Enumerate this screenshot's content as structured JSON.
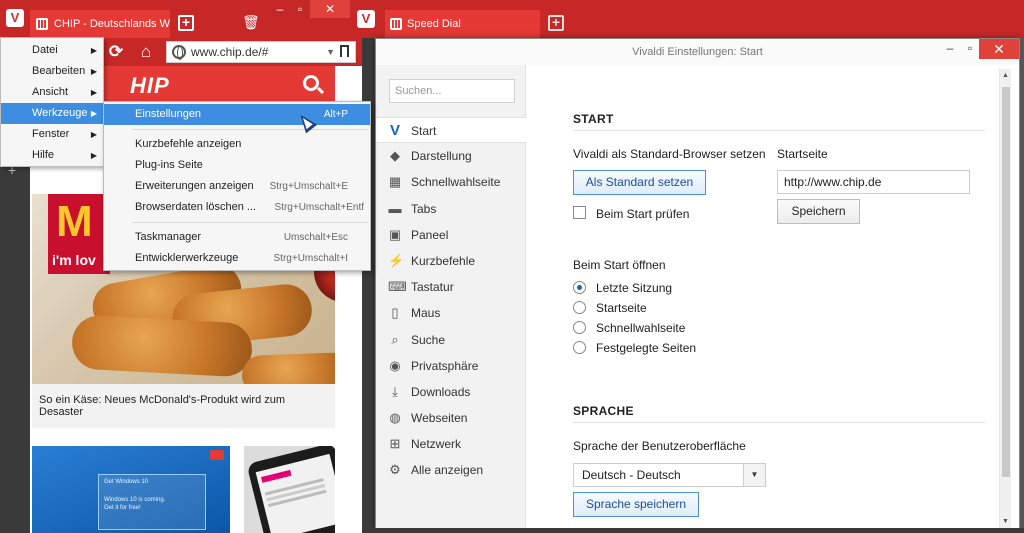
{
  "left_browser": {
    "tab_title": "CHIP - Deutschlands W",
    "address": "www.chip.de/#",
    "chip_logo": "HIP",
    "article": {
      "badge_letter": "M",
      "badge_text": "i'm lov",
      "title": "So ein Käse: Neues McDonald's-Produkt wird zum Desaster"
    },
    "win10_text": {
      "line1": "Get Windows 10",
      "line2": "Windows 10 is coming.",
      "line3": "Get it for free!"
    }
  },
  "main_menu": {
    "items": [
      {
        "label": "Datei",
        "highlighted": false
      },
      {
        "label": "Bearbeiten",
        "highlighted": false
      },
      {
        "label": "Ansicht",
        "highlighted": false
      },
      {
        "label": "Werkzeuge",
        "highlighted": true
      },
      {
        "label": "Fenster",
        "highlighted": false
      },
      {
        "label": "Hilfe",
        "highlighted": false
      }
    ]
  },
  "sub_menu": {
    "groups": [
      [
        {
          "label": "Einstellungen",
          "shortcut": "Alt+P",
          "highlighted": true
        }
      ],
      [
        {
          "label": "Kurzbefehle anzeigen",
          "shortcut": ""
        },
        {
          "label": "Plug-ins Seite",
          "shortcut": ""
        },
        {
          "label": "Erweiterungen anzeigen",
          "shortcut": "Strg+Umschalt+E"
        },
        {
          "label": "Browserdaten löschen ...",
          "shortcut": "Strg+Umschalt+Entf"
        }
      ],
      [
        {
          "label": "Taskmanager",
          "shortcut": "Umschalt+Esc"
        },
        {
          "label": "Entwicklerwerkzeuge",
          "shortcut": "Strg+Umschalt+I"
        }
      ]
    ]
  },
  "right_browser": {
    "tab_title": "Speed Dial"
  },
  "settings": {
    "window_title": "Vivaldi Einstellungen: Start",
    "search_placeholder": "Suchen...",
    "nav": [
      {
        "label": "Start",
        "icon": "vivaldi-v-icon",
        "active": true
      },
      {
        "label": "Darstellung",
        "icon": "paint-bucket-icon"
      },
      {
        "label": "Schnellwahlseite",
        "icon": "grid-icon"
      },
      {
        "label": "Tabs",
        "icon": "tabs-icon"
      },
      {
        "label": "Paneel",
        "icon": "panel-icon"
      },
      {
        "label": "Kurzbefehle",
        "icon": "lightning-icon"
      },
      {
        "label": "Tastatur",
        "icon": "keyboard-icon"
      },
      {
        "label": "Maus",
        "icon": "mouse-icon"
      },
      {
        "label": "Suche",
        "icon": "search-icon"
      },
      {
        "label": "Privatsphäre",
        "icon": "eye-icon"
      },
      {
        "label": "Downloads",
        "icon": "download-icon"
      },
      {
        "label": "Webseiten",
        "icon": "globe-icon"
      },
      {
        "label": "Netzwerk",
        "icon": "network-icon"
      },
      {
        "label": "Alle anzeigen",
        "icon": "gear-icon"
      }
    ],
    "start": {
      "heading": "START",
      "default_browser_label": "Vivaldi als Standard-Browser setzen",
      "set_default_button": "Als Standard setzen",
      "check_on_start_label": "Beim Start prüfen",
      "homepage_label": "Startseite",
      "homepage_value": "http://www.chip.de",
      "save_button": "Speichern",
      "on_start_label": "Beim Start öffnen",
      "on_start_options": [
        {
          "label": "Letzte Sitzung",
          "selected": true
        },
        {
          "label": "Startseite",
          "selected": false
        },
        {
          "label": "Schnellwahlseite",
          "selected": false
        },
        {
          "label": "Festgelegte Seiten",
          "selected": false
        }
      ]
    },
    "language": {
      "heading": "SPRACHE",
      "ui_language_label": "Sprache der Benutzeroberfläche",
      "selected_language": "Deutsch - Deutsch",
      "save_language_button": "Sprache speichern"
    }
  }
}
